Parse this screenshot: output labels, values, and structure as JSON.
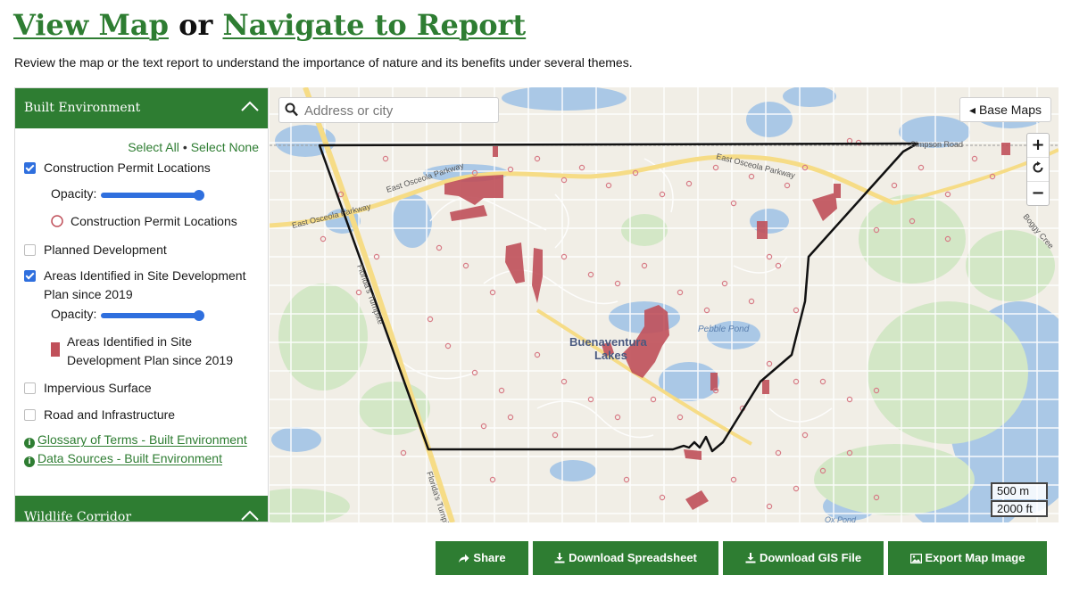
{
  "header": {
    "view_map": "View Map",
    "or": "or",
    "navigate": "Navigate to Report",
    "intro": "Review the map or the text report to understand the importance of nature and its benefits under several themes."
  },
  "panel": {
    "section_title": "Built Environment",
    "select_all": "Select All",
    "select_separator": "•",
    "select_none": "Select None",
    "opacity_label": "Opacity:",
    "layers": [
      {
        "label": "Construction Permit Locations",
        "checked": true,
        "legend": "Construction Permit Locations"
      },
      {
        "label": "Planned Development",
        "checked": false
      },
      {
        "label_line1": "Areas Identified in Site Development",
        "label_line2": "Plan since 2019",
        "checked": true,
        "legend_line1": "Areas Identified in Site",
        "legend_line2": "Development Plan since 2019"
      },
      {
        "label": "Impervious Surface",
        "checked": false
      },
      {
        "label": "Road and Infrastructure",
        "checked": false
      }
    ],
    "links": [
      {
        "label": "Glossary of Terms - Built Environment"
      },
      {
        "label": "Data Sources - Built Environment"
      }
    ],
    "next_section_title": "Wildlife Corridor"
  },
  "map": {
    "search_placeholder": "Address or city",
    "base_maps": "◂ Base Maps",
    "zoom_in": "+",
    "zoom_out": "−",
    "scale_metric": "500 m",
    "scale_imperial": "2000 ft",
    "labels": {
      "parkway_1": "East Osceola Parkway",
      "parkway_2": "East Osceola Parkway",
      "parkway_3": "East Osceola Parkway",
      "turnpike": "Florida's Turnpike",
      "turnpike_2": "Florida's Turnpike",
      "simpson": "Simpson Road",
      "boggy": "Boggy Cree",
      "town_1": "Buenaventura",
      "town_2": "Lakes",
      "pebble": "Pebble Pond",
      "ox": "Ox Pond"
    }
  },
  "actions": {
    "share": "Share",
    "spreadsheet": "Download Spreadsheet",
    "gis": "Download GIS File",
    "export": "Export Map Image"
  },
  "colors": {
    "brand_green": "#2e7d32",
    "accent_blue": "#2f6fde",
    "site_dev": "#c0505a"
  }
}
